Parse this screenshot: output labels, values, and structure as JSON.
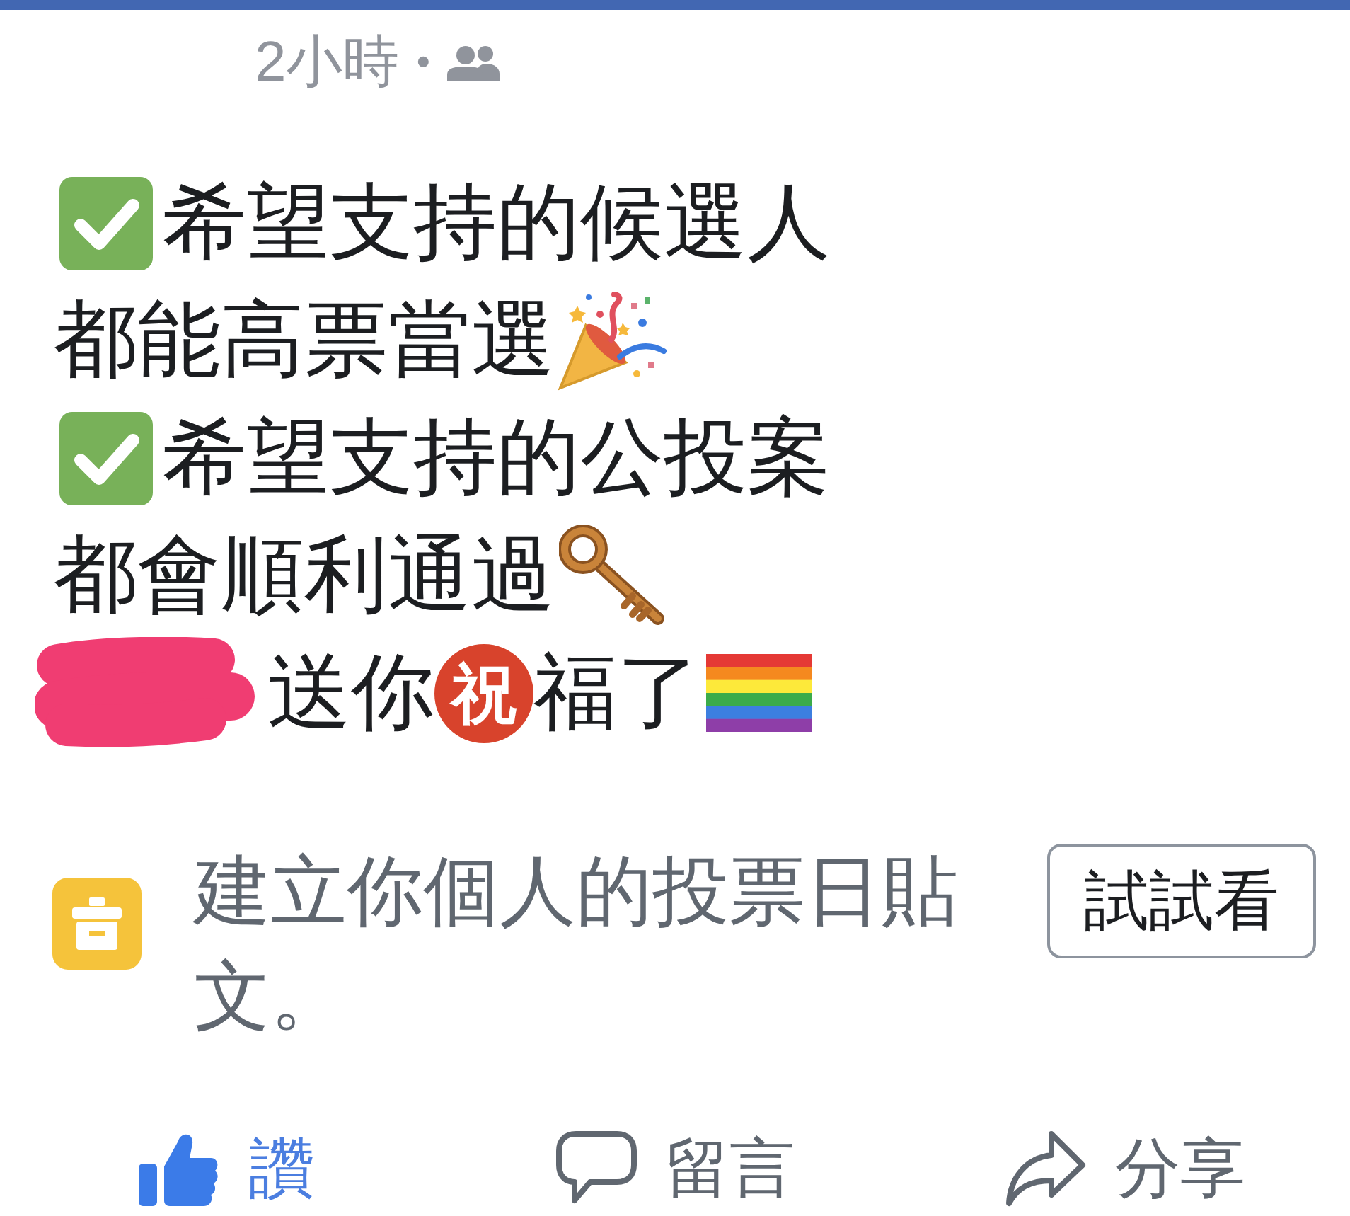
{
  "header": {
    "time": "2小時",
    "separator": "•"
  },
  "post": {
    "lines": [
      {
        "segments": [
          {
            "kind": "check"
          },
          {
            "kind": "text",
            "text": "希望支持的候選人"
          }
        ]
      },
      {
        "segments": [
          {
            "kind": "text",
            "text": "都能高票當選"
          },
          {
            "kind": "party"
          }
        ]
      },
      {
        "segments": [
          {
            "kind": "check"
          },
          {
            "kind": "text",
            "text": "希望支持的公投案"
          }
        ]
      },
      {
        "segments": [
          {
            "kind": "text",
            "text": "都會順利通過"
          },
          {
            "kind": "key"
          }
        ]
      },
      {
        "segments": [
          {
            "kind": "redaction"
          },
          {
            "kind": "text",
            "text": "送你"
          },
          {
            "kind": "badge",
            "text": "祝"
          },
          {
            "kind": "text",
            "text": "福了"
          },
          {
            "kind": "rainbow"
          }
        ]
      }
    ]
  },
  "prompt": {
    "text": "建立你個人的投票日貼文。",
    "button": "試試看"
  },
  "actions": [
    {
      "kind": "like",
      "label": "讚",
      "selected": true
    },
    {
      "kind": "comment",
      "label": "留言",
      "selected": false
    },
    {
      "kind": "share",
      "label": "分享",
      "selected": false
    }
  ]
}
